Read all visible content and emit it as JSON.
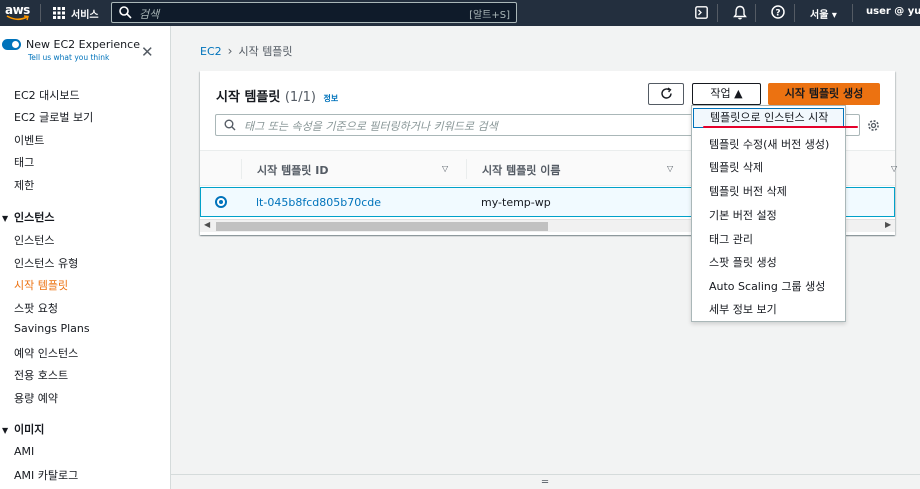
{
  "topnav": {
    "logo_text": "aws",
    "services_label": "서비스",
    "search_placeholder": "검색",
    "search_shortcut": "[알트+S]",
    "region_label": "서울 ▾",
    "account_label": "user @ yun-a"
  },
  "sidebar": {
    "experience_title": "New EC2 Experience",
    "experience_link": "Tell us what you think",
    "top_items": [
      "EC2 대시보드",
      "EC2 글로벌 보기",
      "이벤트",
      "태그",
      "제한"
    ],
    "section_instances": "인스턴스",
    "instance_items": [
      "인스턴스",
      "인스턴스 유형",
      "시작 템플릿",
      "스팟 요청",
      "Savings Plans",
      "예약 인스턴스",
      "전용 호스트",
      "용량 예약"
    ],
    "active_item": "시작 템플릿",
    "section_images": "이미지",
    "image_items": [
      "AMI",
      "AMI 카탈로그"
    ]
  },
  "breadcrumb": {
    "root": "EC2",
    "current": "시작 템플릿"
  },
  "panel": {
    "title": "시작 템플릿",
    "count": "(1/1)",
    "info": "정보",
    "actions_label": "작업 ▲",
    "create_label": "시작 템플릿 생성",
    "filter_placeholder": "태그 또는 속성을 기준으로 필터링하거나 키워드로 검색",
    "columns": [
      "시작 템플릿 ID",
      "시작 템플릿 이름"
    ],
    "rows": [
      {
        "id": "lt-045b8fcd805b70cde",
        "name": "my-temp-wp",
        "selected": true
      }
    ]
  },
  "actions_menu": {
    "items": [
      "템플릿으로 인스턴스 시작",
      "템플릿 수정(새 버전 생성)",
      "템플릿 삭제",
      "템플릿 버전 삭제",
      "기본 버전 설정",
      "태그 관리",
      "스팟 플릿 생성",
      "Auto Scaling 그룹 생성",
      "세부 정보 보기"
    ],
    "highlighted_index": 0
  },
  "colors": {
    "nav_bg": "#232f3e",
    "accent_orange": "#ec7211",
    "link_blue": "#0073bb",
    "annotation_red": "#e4002b"
  }
}
